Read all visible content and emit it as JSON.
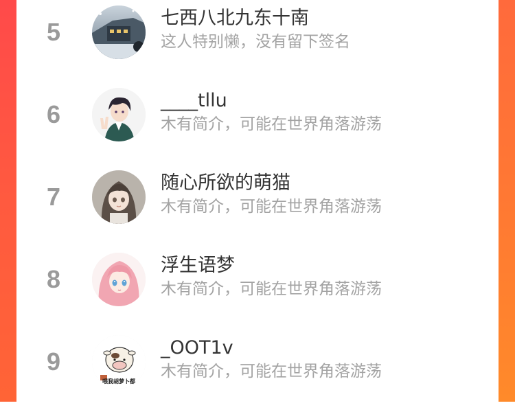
{
  "leaderboard": {
    "entries": [
      {
        "rank": "5",
        "name": "七西八北九东十南",
        "bio": "这人特别懒，没有留下签名",
        "avatar": "night-train-scene-avatar"
      },
      {
        "rank": "6",
        "name": "____tllu",
        "bio": "木有简介，可能在世界角落游荡",
        "avatar": "anime-boy-peace-sign-avatar"
      },
      {
        "rank": "7",
        "name": "随心所欲的萌猫",
        "bio": "木有简介，可能在世界角落游荡",
        "avatar": "anime-girl-dark-hair-avatar"
      },
      {
        "rank": "8",
        "name": "浮生语梦",
        "bio": "木有简介，可能在世界角落游荡",
        "avatar": "anime-girl-pink-hair-avatar"
      },
      {
        "rank": "9",
        "name": "_OOT1v",
        "bio": "木有简介，可能在世界角落游荡",
        "avatar": "cartoon-cow-sticker-avatar",
        "avatar_caption": "喂我胡萝卜都"
      }
    ]
  },
  "colors": {
    "edge_red": "#ff4a4a",
    "edge_orange": "#ff7a32",
    "rank_gray": "#9a9a9a",
    "name_text": "#333333",
    "bio_text": "#a3a3a3"
  }
}
